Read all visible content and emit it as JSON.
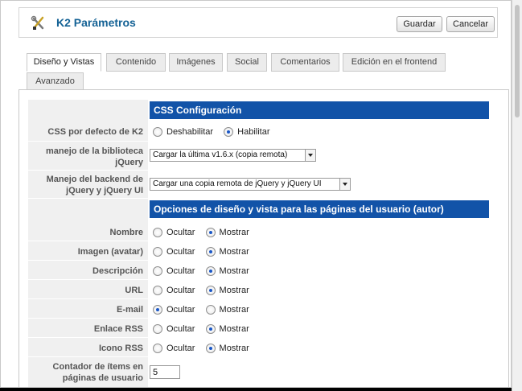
{
  "header": {
    "title": "K2 Parámetros",
    "save_label": "Guardar",
    "cancel_label": "Cancelar",
    "icon": "tools-icon"
  },
  "tabs": [
    {
      "label": "Diseño y Vistas",
      "active": true
    },
    {
      "label": "Contenido",
      "active": false
    },
    {
      "label": "Imágenes",
      "active": false
    },
    {
      "label": "Social",
      "active": false
    },
    {
      "label": "Comentarios",
      "active": false
    },
    {
      "label": "Edición en el frontend",
      "active": false
    },
    {
      "label": "Avanzado",
      "active": false
    }
  ],
  "sections": {
    "css": "CSS Configuración",
    "user": "Opciones de diseño y vista para las páginas del usuario (autor)"
  },
  "fields": {
    "css_default": {
      "label": "CSS por defecto de K2",
      "opt_disable": "Deshabilitar",
      "opt_enable": "Habilitar",
      "selected": "Habilitar"
    },
    "jquery_lib": {
      "label_1": "manejo de la biblioteca",
      "label_2": "jQuery",
      "value": "Cargar la última v1.6.x (copia remota)"
    },
    "jquery_backend": {
      "label_1": "Manejo del backend de",
      "label_2": "jQuery y jQuery UI",
      "value": "Cargar una copia remota de jQuery y jQuery UI"
    },
    "rows": [
      {
        "label": "Nombre",
        "hide": "Ocultar",
        "show": "Mostrar",
        "selected": "Mostrar"
      },
      {
        "label": "Imagen (avatar)",
        "hide": "Ocultar",
        "show": "Mostrar",
        "selected": "Mostrar"
      },
      {
        "label": "Descripción",
        "hide": "Ocultar",
        "show": "Mostrar",
        "selected": "Mostrar"
      },
      {
        "label": "URL",
        "hide": "Ocultar",
        "show": "Mostrar",
        "selected": "Mostrar"
      },
      {
        "label": "E-mail",
        "hide": "Ocultar",
        "show": "Mostrar",
        "selected": "Ocultar"
      },
      {
        "label": "Enlace RSS",
        "hide": "Ocultar",
        "show": "Mostrar",
        "selected": "Mostrar"
      },
      {
        "label": "Icono RSS",
        "hide": "Ocultar",
        "show": "Mostrar",
        "selected": "Mostrar"
      }
    ],
    "item_count": {
      "label_1": "Contador de ítems en",
      "label_2": "páginas de usuario",
      "value": "5"
    }
  },
  "colors": {
    "title": "#146295",
    "section_bar": "#1253a8",
    "label_bg": "#f0f0f0"
  }
}
